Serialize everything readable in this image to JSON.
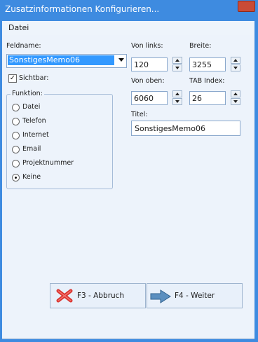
{
  "window": {
    "title": "Zusatzinformationen Konfigurieren..."
  },
  "menu": {
    "file_label": "Datei"
  },
  "form": {
    "fieldname_label": "Feldname:",
    "fieldname_value": "SonstigesMemo06",
    "visible_label": "Sichtbar:",
    "visible_checked": true,
    "function_legend": "Funktion:",
    "functions": [
      "Datei",
      "Telefon",
      "Internet",
      "Email",
      "Projektnummer",
      "Keine"
    ],
    "selected_function": "Keine",
    "from_left_label": "Von links:",
    "from_left_value": "120",
    "width_label": "Breite:",
    "width_value": "3255",
    "from_top_label": "Von oben:",
    "from_top_value": "6060",
    "tab_index_label": "TAB Index:",
    "tab_index_value": "26",
    "title_label": "Titel:",
    "title_value": "SonstigesMemo06"
  },
  "buttons": {
    "cancel_label": "F3 - Abbruch",
    "next_label": "F4 - Weiter"
  }
}
